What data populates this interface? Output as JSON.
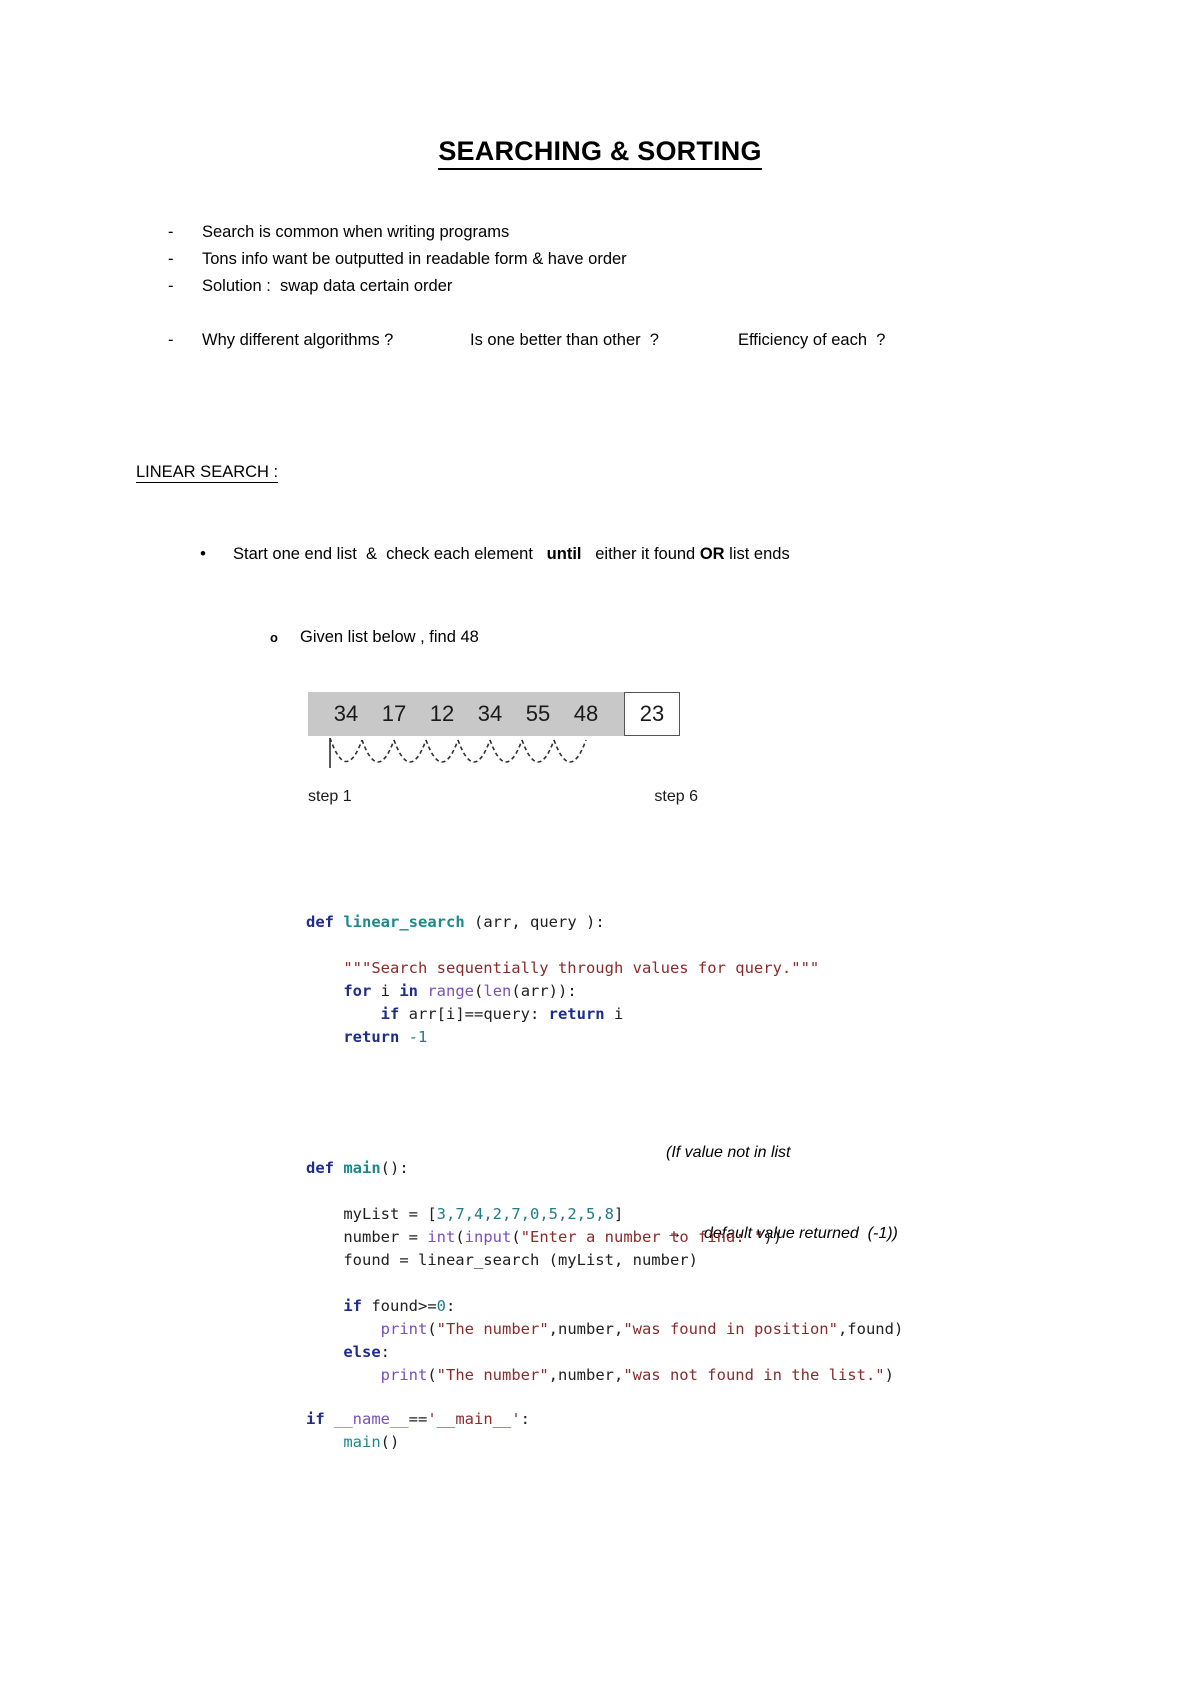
{
  "document": {
    "title": "SEARCHING & SORTING",
    "intro_bullets": [
      {
        "mark": "-",
        "text": "Search is common when writing programs"
      },
      {
        "mark": "-",
        "text": "Tons info want be outputted in readable form & have order"
      },
      {
        "mark": "-",
        "text": "Solution :  swap data certain order"
      }
    ],
    "question_bullet": {
      "mark": "-",
      "q1": "Why different algorithms ?",
      "q2": "Is one better than other  ?",
      "q3": "Efficiency of each  ?"
    },
    "section": {
      "heading": "LINEAR SEARCH  :",
      "bullet_mark": "•",
      "bullet_pre": "Start one end list  &  check each element   ",
      "bullet_bold1": "until",
      "bullet_mid": "   either it found ",
      "bullet_bold2": "OR",
      "bullet_post": " list ends",
      "sub_mark": "o",
      "sub_text": "Given list below , find 48"
    },
    "diagram": {
      "values": [
        "34",
        "17",
        "12",
        "34",
        "55",
        "48"
      ],
      "highlight_value": "23",
      "step_first": "step 1",
      "step_last": "step 6",
      "gray_color": "#c8c8c8",
      "box_border_color": "#555555"
    },
    "code_linear_search": {
      "line1_kw": "def",
      "line1_fn": "linear_search",
      "line1_rest": " (arr, query ):",
      "line2_doc": "\"\"\"Search sequentially through values for query.\"\"\"",
      "line3_kw": "for",
      "line3_mid": " i ",
      "line3_kw2": "in",
      "line3_bi": "range",
      "line3_bi2": "len",
      "line3_rest": "(arr)):",
      "line4_kw": "if",
      "line4_mid": " arr[i]==query: ",
      "line4_kw2": "return",
      "line4_rest": " i",
      "line5_kw": "return",
      "line5_num": "-1"
    },
    "note": {
      "line1": "(If value not in list",
      "arrow": "→",
      "line2": "default value returned  (-1))"
    },
    "code_main": {
      "line1_kw": "def",
      "line1_fn": "main",
      "line1_rest": "():",
      "line2_name": "myList = ",
      "line2_list_open": "[",
      "line2_nums": "3,7,4,2,7,0,5,2,5,8",
      "line2_list_close": "]",
      "line3_name": "number = ",
      "line3_bi": "int",
      "line3_open": "(",
      "line3_bi2": "input",
      "line3_str": "\"Enter a number to find: \"",
      "line3_close": "))",
      "line4": "found = linear_search (myList, number)",
      "line5_kw": "if",
      "line5_rest": " found>=",
      "line5_num": "0",
      "line5_colon": ":",
      "line6_bi": "print",
      "line6_open": "(",
      "line6_str1": "\"The number\"",
      "line6_mid": ",number,",
      "line6_str2": "\"was found in position\"",
      "line6_rest": ",found)",
      "line7_kw": "else",
      "line7_colon": ":",
      "line8_bi": "print",
      "line8_open": "(",
      "line8_str1": "\"The number\"",
      "line8_mid": ",number,",
      "line8_str2": "\"was not found in the list.\"",
      "line8_rest": ")"
    },
    "code_entry": {
      "line1_kw": "if",
      "line1_dunder": " __name__",
      "line1_eq": "==",
      "line1_str": "'__main__'",
      "line1_colon": ":",
      "line2_fn": "main",
      "line2_rest": "()"
    }
  }
}
